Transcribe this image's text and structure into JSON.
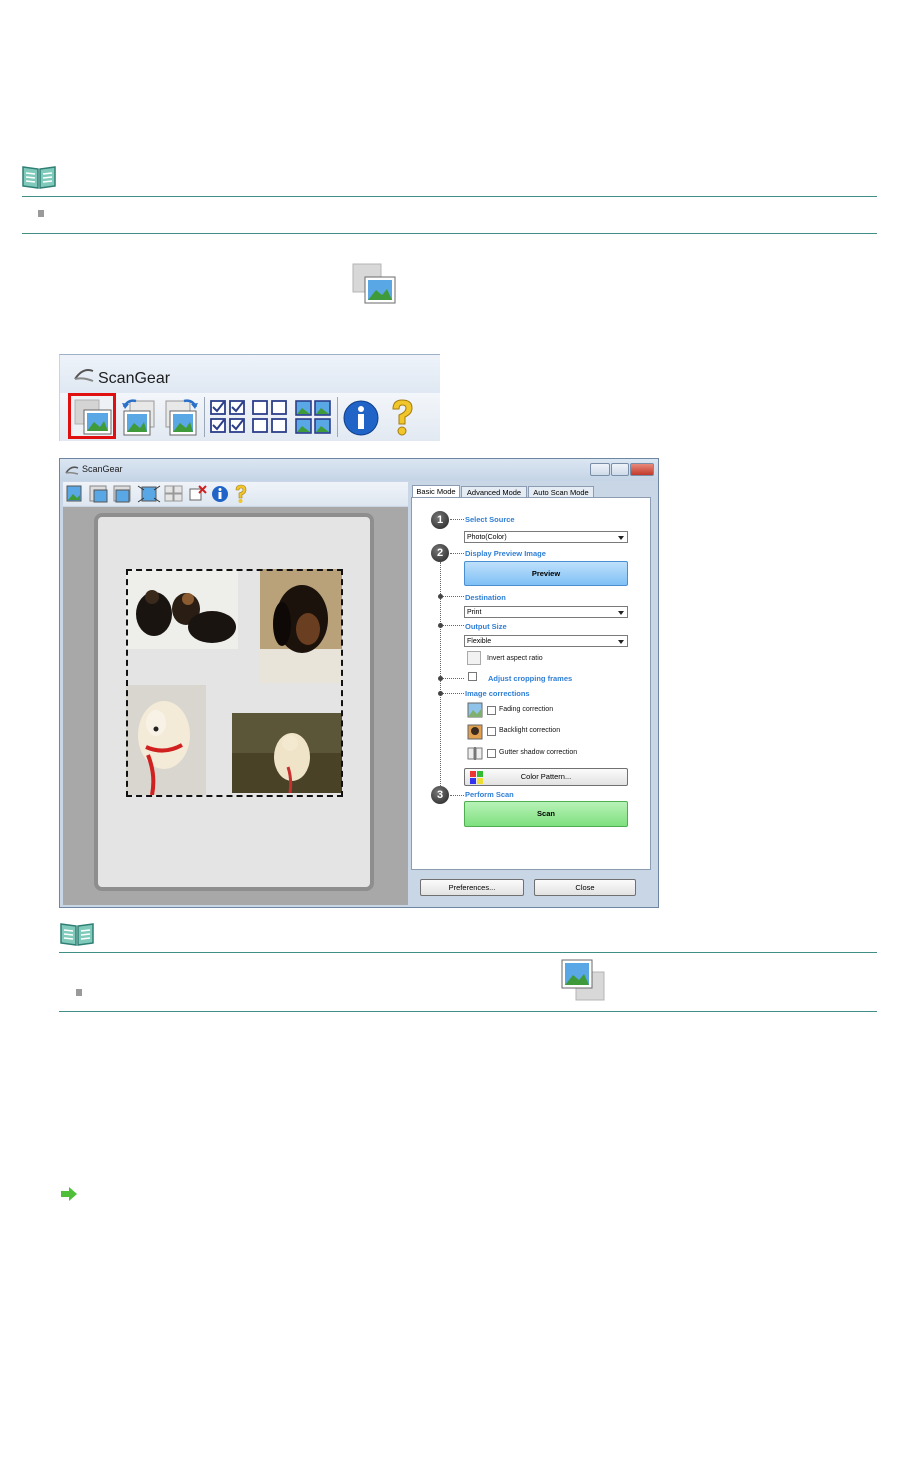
{
  "toolbar_crop": {
    "title": "ScanGear"
  },
  "window": {
    "title": "ScanGear",
    "tabs": [
      "Basic Mode",
      "Advanced Mode",
      "Auto Scan Mode"
    ],
    "steps": {
      "select_source": "Select Source",
      "source_value": "Photo(Color)",
      "display_preview": "Display Preview Image",
      "preview_button": "Preview",
      "destination": "Destination",
      "destination_value": "Print",
      "output_size": "Output Size",
      "output_size_value": "Flexible",
      "invert_aspect_ratio": "Invert aspect ratio",
      "adjust_cropping_frames": "Adjust cropping frames",
      "image_corrections": "Image corrections",
      "fading_correction": "Fading correction",
      "backlight_correction": "Backlight correction",
      "gutter_shadow_correction": "Gutter shadow correction",
      "color_pattern_button": "Color Pattern...",
      "perform_scan": "Perform Scan",
      "scan_button": "Scan"
    },
    "footer": {
      "preferences_button": "Preferences...",
      "close_button": "Close"
    }
  },
  "icons": {
    "note": "note-book-icon",
    "multi_crop": "multi-crop-icon",
    "single_crop": "single-crop-icon",
    "next_step": "green-arrow-icon"
  },
  "colors": {
    "accent_line": "#3f8f86",
    "step_label": "#2f7fd6",
    "preview_button": "#7fc0f5",
    "scan_button": "#7ee07e",
    "highlight_box": "#e01010",
    "arrow": "#4fbf3a"
  }
}
